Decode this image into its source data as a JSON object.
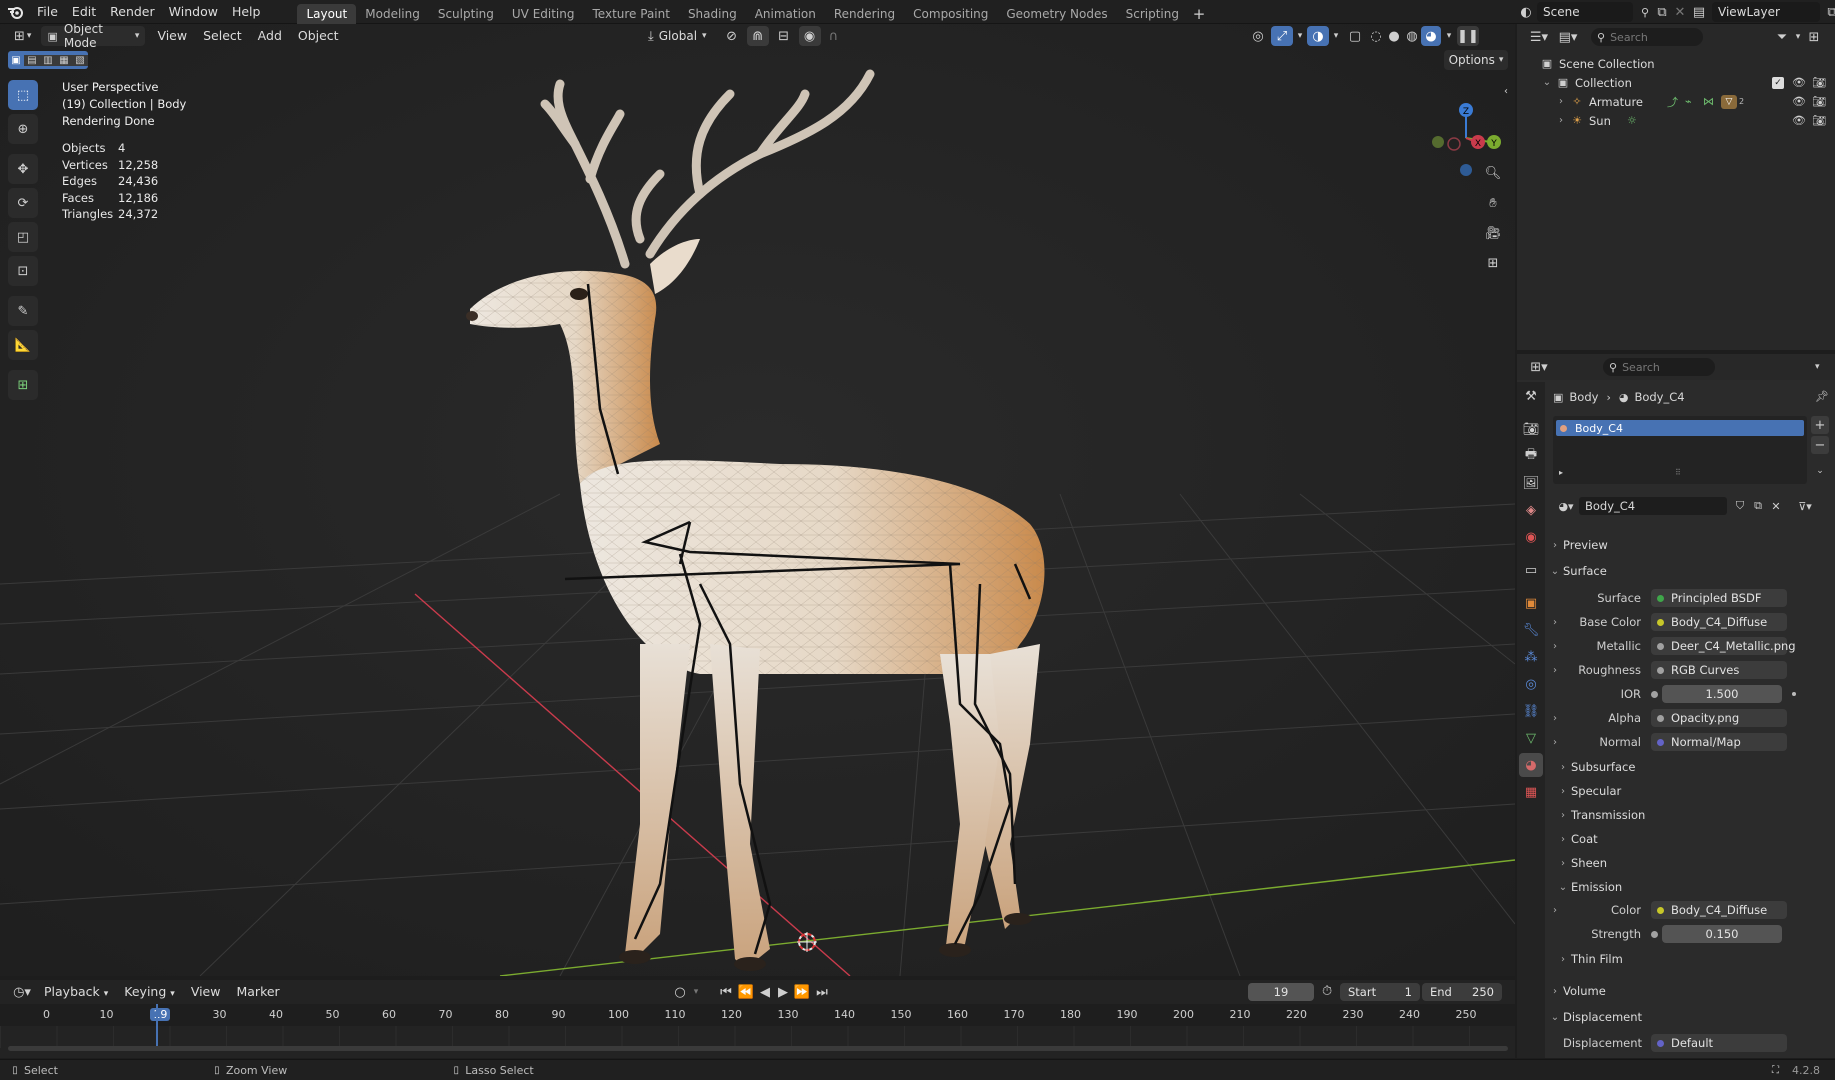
{
  "topbar": {
    "menus": [
      "File",
      "Edit",
      "Render",
      "Window",
      "Help"
    ],
    "workspaces": [
      "Layout",
      "Modeling",
      "Sculpting",
      "UV Editing",
      "Texture Paint",
      "Shading",
      "Animation",
      "Rendering",
      "Compositing",
      "Geometry Nodes",
      "Scripting"
    ],
    "active_workspace": "Layout",
    "scene": "Scene",
    "view_layer": "ViewLayer"
  },
  "viewport": {
    "mode": "Object Mode",
    "menus": [
      "View",
      "Select",
      "Add",
      "Object"
    ],
    "transform_orientation": "Global",
    "options_label": "Options",
    "info": {
      "perspective": "User Perspective",
      "collection": "(19) Collection | Body",
      "render_status": "Rendering Done"
    },
    "stats": [
      {
        "label": "Objects",
        "value": "4"
      },
      {
        "label": "Vertices",
        "value": "12,258"
      },
      {
        "label": "Edges",
        "value": "24,436"
      },
      {
        "label": "Faces",
        "value": "12,186"
      },
      {
        "label": "Triangles",
        "value": "24,372"
      }
    ],
    "gizmo": {
      "z": "Z",
      "y": "Y",
      "x": "X"
    }
  },
  "outliner": {
    "search_placeholder": "Search",
    "root": "Scene Collection",
    "collection": "Collection",
    "items": [
      {
        "name": "Armature"
      },
      {
        "name": "Sun"
      }
    ],
    "armature_badge": "2"
  },
  "properties": {
    "search_placeholder": "Search",
    "breadcrumb_object": "Body",
    "breadcrumb_material": "Body_C4",
    "slot_name": "Body_C4",
    "material_name": "Body_C4",
    "sections": {
      "preview": "Preview",
      "surface": "Surface",
      "subsurface": "Subsurface",
      "specular": "Specular",
      "transmission": "Transmission",
      "coat": "Coat",
      "sheen": "Sheen",
      "emission": "Emission",
      "thin_film": "Thin Film",
      "volume": "Volume",
      "displacement": "Displacement"
    },
    "surface_rows": [
      {
        "label": "Surface",
        "value": "Principled BSDF",
        "color": "#3fa64a"
      },
      {
        "label": "Base Color",
        "value": "Body_C4_Diffuse",
        "color": "#c7c729"
      },
      {
        "label": "Metallic",
        "value": "Deer_C4_Metallic.png",
        "color": "#a1a1a1"
      },
      {
        "label": "Roughness",
        "value": "RGB Curves",
        "color": "#a1a1a1"
      },
      {
        "label": "IOR",
        "value": "1.500",
        "color": "#a1a1a1"
      },
      {
        "label": "Alpha",
        "value": "Opacity.png",
        "color": "#a1a1a1"
      },
      {
        "label": "Normal",
        "value": "Normal/Map",
        "color": "#6363c7"
      }
    ],
    "emission_rows": [
      {
        "label": "Color",
        "value": "Body_C4_Diffuse",
        "color": "#c7c729"
      },
      {
        "label": "Strength",
        "value": "0.150",
        "color": "#a1a1a1"
      }
    ],
    "displacement_row": {
      "label": "Displacement",
      "value": "Default",
      "color": "#6363c7"
    }
  },
  "timeline": {
    "menus": [
      "Playback",
      "Keying",
      "View",
      "Marker"
    ],
    "current_frame": "19",
    "start_label": "Start",
    "start": "1",
    "end_label": "End",
    "end": "250",
    "ticks": [
      "0",
      "10",
      "19",
      "30",
      "40",
      "50",
      "60",
      "70",
      "80",
      "90",
      "100",
      "110",
      "120",
      "130",
      "140",
      "150",
      "160",
      "170",
      "180",
      "190",
      "200",
      "210",
      "220",
      "230",
      "240",
      "250"
    ]
  },
  "statusbar": {
    "select": "Select",
    "zoom": "Zoom View",
    "lasso": "Lasso Select",
    "version": "4.2.8"
  },
  "colors": {
    "accent": "#4772b3",
    "selection": "#4772b3",
    "x_axis": "#c93b4c",
    "y_axis": "#7bab2f",
    "z_axis": "#3a7bd5"
  }
}
